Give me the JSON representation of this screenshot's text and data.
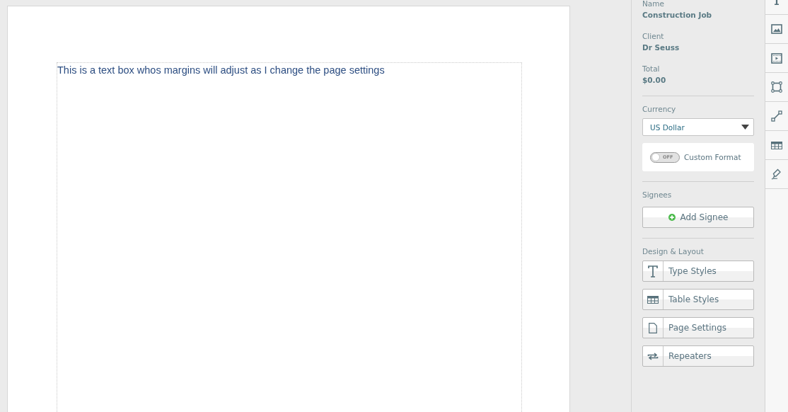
{
  "document": {
    "text_box": "This is a text box whos margins will adjust as I change the page settings"
  },
  "sidebar": {
    "fields": [
      {
        "label": "Name",
        "value": "Construction Job"
      },
      {
        "label": "Client",
        "value": "Dr Seuss"
      },
      {
        "label": "Total",
        "value": "$0.00"
      }
    ],
    "currency": {
      "label": "Currency",
      "value": "US Dollar"
    },
    "custom_format": {
      "on": false,
      "switch_text": "OFF",
      "label": "Custom Format"
    },
    "signees": {
      "label": "Signees",
      "button": "Add Signee"
    },
    "design": {
      "label": "Design & Layout",
      "buttons": [
        {
          "kind": "type",
          "label": "Type Styles"
        },
        {
          "kind": "table",
          "label": "Table Styles"
        },
        {
          "kind": "page",
          "label": "Page Settings"
        },
        {
          "kind": "repeat",
          "label": "Repeaters"
        }
      ]
    }
  }
}
